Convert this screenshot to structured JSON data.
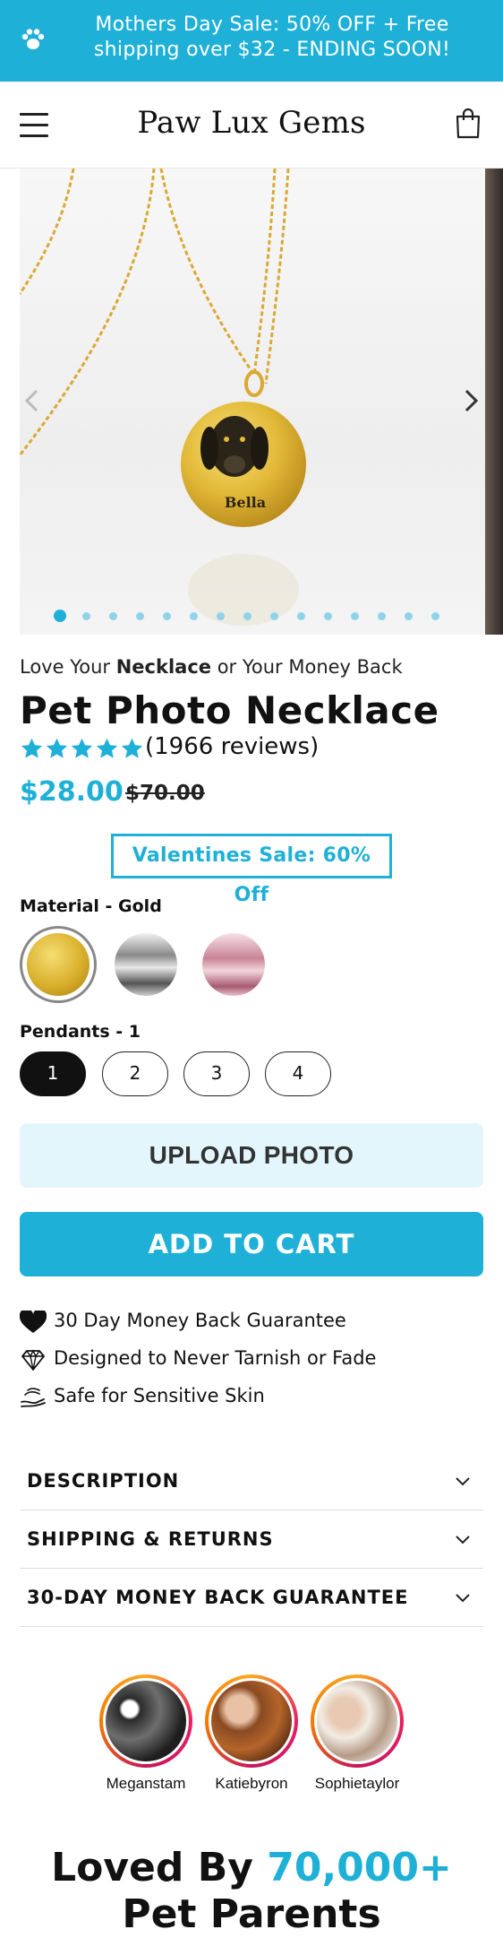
{
  "announcement": {
    "text": "Mothers Day Sale: 50% OFF + Free shipping over $32 - ENDING SOON!",
    "icon": "paw-icon"
  },
  "header": {
    "brand": "Paw Lux Gems",
    "menu_icon": "hamburger-icon",
    "cart_icon": "shopping-bag-icon"
  },
  "gallery": {
    "engraving": "Bella",
    "slide_count": 15,
    "active_slide": 1,
    "prev_icon": "chevron-left-icon",
    "next_icon": "chevron-right-icon"
  },
  "product": {
    "tagline_before": "Love Your ",
    "tagline_bold": "Necklace",
    "tagline_after": " or Your Money Back",
    "title": "Pet Photo Necklace",
    "rating": 5,
    "reviews": "(1966 reviews)",
    "price": "$28.00",
    "compare_price": "$70.00",
    "sale_badge": "Valentines Sale: 60% Off"
  },
  "material": {
    "label": "Material - Gold",
    "options": [
      {
        "name": "Gold",
        "selected": true
      },
      {
        "name": "Silver",
        "selected": false
      },
      {
        "name": "Rose Gold",
        "selected": false
      }
    ]
  },
  "pendants": {
    "label": "Pendants - 1",
    "options": [
      "1",
      "2",
      "3",
      "4"
    ],
    "selected": "1"
  },
  "buttons": {
    "upload": "UPLOAD PHOTO",
    "add_to_cart": "ADD TO CART"
  },
  "benefits": [
    {
      "icon": "heart-icon",
      "text": "30 Day Money Back Guarantee"
    },
    {
      "icon": "diamond-icon",
      "text": "Designed to Never Tarnish or Fade"
    },
    {
      "icon": "hand-care-icon",
      "text": "Safe for Sensitive Skin"
    }
  ],
  "accordion": [
    {
      "title": "DESCRIPTION"
    },
    {
      "title": "SHIPPING & RETURNS"
    },
    {
      "title": "30-DAY MONEY BACK GUARANTEE"
    }
  ],
  "influencers": [
    {
      "name": "Meganstam"
    },
    {
      "name": "Katiebyron"
    },
    {
      "name": "Sophietaylor"
    }
  ],
  "loved": {
    "prefix": "Loved By ",
    "highlight": "70,000+",
    "suffix": "Pet Parents"
  },
  "colors": {
    "accent": "#1fb0d8",
    "light_accent": "#e2f6fc",
    "text": "#111111"
  }
}
